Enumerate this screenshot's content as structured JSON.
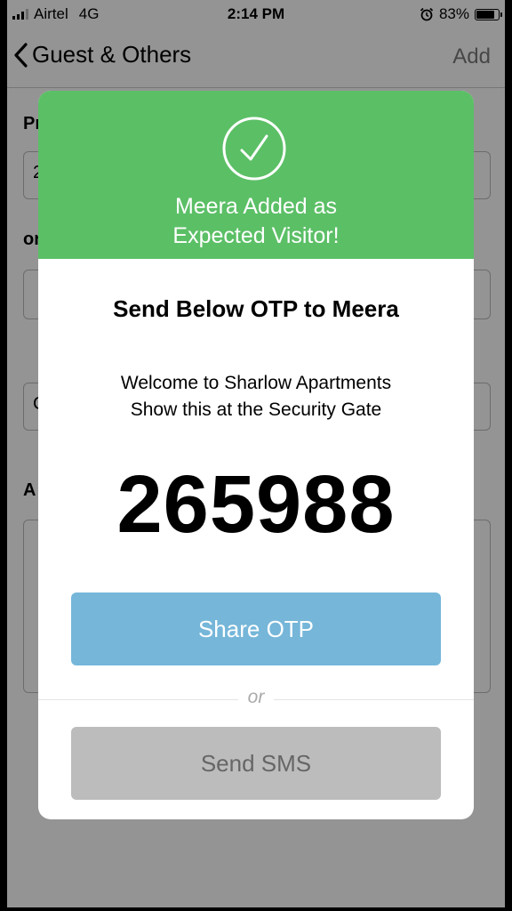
{
  "status_bar": {
    "carrier": "Airtel",
    "network": "4G",
    "time": "2:14 PM",
    "battery": "83%",
    "battery_fraction": 0.83
  },
  "nav": {
    "title": "Guest & Others",
    "add_label": "Add"
  },
  "background_form": {
    "label_1": "Pr",
    "field_1_value": "2",
    "label_2": "or",
    "field_3_value": "C",
    "label_3": "A"
  },
  "modal": {
    "header_line1": "Meera Added as",
    "header_line2": "Expected Visitor!",
    "otp_title": "Send Below OTP to Meera",
    "welcome_line1": "Welcome to Sharlow Apartments",
    "welcome_line2": "Show this at the Security Gate",
    "otp_code": "265988",
    "share_button": "Share OTP",
    "or_text": "or",
    "sms_button": "Send SMS"
  },
  "colors": {
    "header_green": "#5bbf66",
    "share_blue": "#75b6d9",
    "sms_gray": "#bcbcbc"
  },
  "icons": [
    "back-chevron-icon",
    "checkmark-circle-icon",
    "alarm-icon",
    "battery-icon",
    "signal-icon"
  ]
}
